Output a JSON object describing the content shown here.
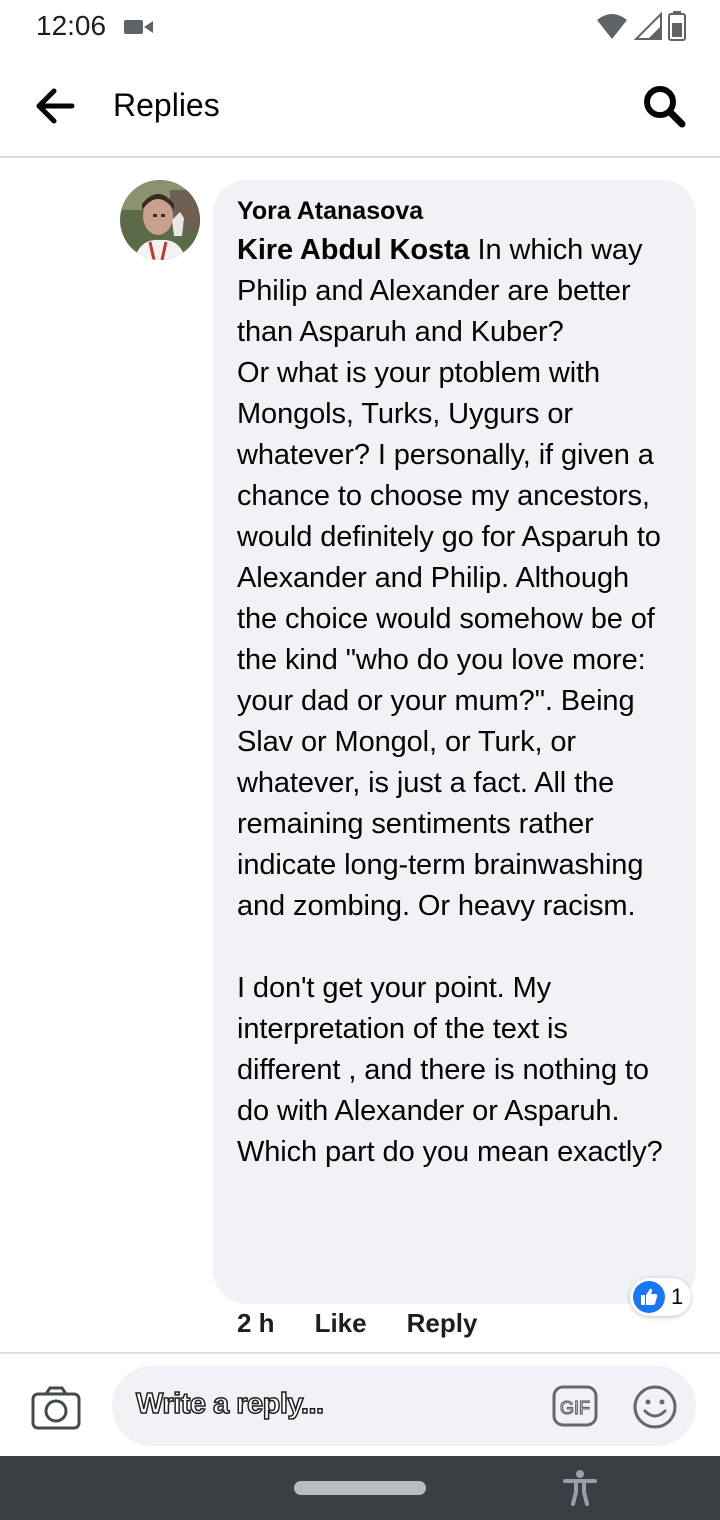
{
  "status": {
    "time": "12:06"
  },
  "header": {
    "title": "Replies"
  },
  "comment": {
    "author": "Yora Atanasova",
    "mention": "Kire Abdul Kosta",
    "text": " In which way Philip and Alexander are better than Asparuh and Kuber?\n Or what is your  ptoblem with Mongols, Turks, Uygurs or whatever? I personally, if given a chance to choose my ancestors, would definitely go for Asparuh to Alexander and Philip. Although the choice would somehow be of the kind \"who do you love more: your dad or your mum?\". Being Slav or Mongol, or Turk, or whatever, is just a fact. All the remaining sentiments rather indicate  long-term brainwashing and zombing. Or heavy racism.\n\nI don't get your point. My interpretation of the text is different  , and there is nothing to do with Alexander  or Asparuh. Which part do you mean exactly?",
    "age": "2 h",
    "like_label": "Like",
    "reply_label": "Reply",
    "reaction_count": "1"
  },
  "composer": {
    "placeholder": "Write a reply..."
  },
  "icons": {
    "back": "arrow-left-icon",
    "search": "search-icon",
    "camera": "camera-icon",
    "gif": "gif-icon",
    "emoji": "smiley-icon",
    "like": "thumbs-up-icon",
    "accessibility": "accessibility-icon"
  },
  "colors": {
    "accent": "#1877f2",
    "bubble": "#f0f2f5",
    "nav_bar": "#3b3f44"
  }
}
